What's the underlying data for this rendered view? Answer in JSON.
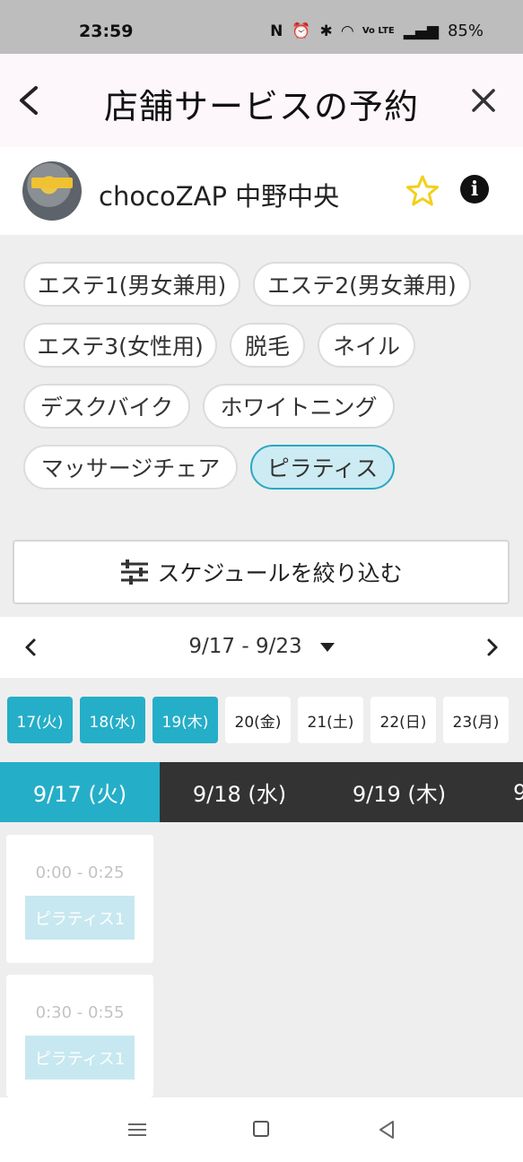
{
  "status_bar": {
    "time": "23:59",
    "nfc": "N",
    "alarm": "⏰",
    "bluetooth": "✱",
    "wifi": "◠",
    "volte": "Vo LTE",
    "signal": "▂▄▆",
    "battery": "85%"
  },
  "header": {
    "title": "店舗サービスの予約",
    "back_icon": "chevron-left-icon",
    "close_icon": "close-icon"
  },
  "store": {
    "name": "chocoZAP 中野中央",
    "favorite_icon": "star-outline-icon",
    "info_icon": "info-icon",
    "info_glyph": "i",
    "star_color": "#f2cf1d"
  },
  "services": [
    {
      "label": "エステ1(男女兼用)",
      "selected": false
    },
    {
      "label": "エステ2(男女兼用)",
      "selected": false
    },
    {
      "label": "エステ3(女性用)",
      "selected": false
    },
    {
      "label": "脱毛",
      "selected": false
    },
    {
      "label": "ネイル",
      "selected": false
    },
    {
      "label": "デスクバイク",
      "selected": false
    },
    {
      "label": "ホワイトニング",
      "selected": false
    },
    {
      "label": "マッサージチェア",
      "selected": false
    },
    {
      "label": "ピラティス",
      "selected": true
    }
  ],
  "filter": {
    "label": "スケジュールを絞り込む",
    "icon": "sliders-icon"
  },
  "week_nav": {
    "range": "9/17 - 9/23"
  },
  "day_chips": [
    {
      "label": "17(火)",
      "available": true
    },
    {
      "label": "18(水)",
      "available": true
    },
    {
      "label": "19(木)",
      "available": true
    },
    {
      "label": "20(金)",
      "available": false
    },
    {
      "label": "21(土)",
      "available": false
    },
    {
      "label": "22(日)",
      "available": false
    },
    {
      "label": "23(月)",
      "available": false
    }
  ],
  "date_tabs": [
    {
      "label": "9/17 (火)",
      "active": true
    },
    {
      "label": "9/18 (水)",
      "active": false
    },
    {
      "label": "9/19 (木)",
      "active": false
    },
    {
      "label": "9",
      "active": false
    }
  ],
  "slots": [
    {
      "time": "0:00 - 0:25",
      "service": "ピラティス1"
    },
    {
      "time": "0:30 - 0:55",
      "service": "ピラティス1"
    }
  ],
  "colors": {
    "accent": "#25aec8",
    "selected_chip_bg": "#cdebf2",
    "tab_bar": "#333333"
  }
}
